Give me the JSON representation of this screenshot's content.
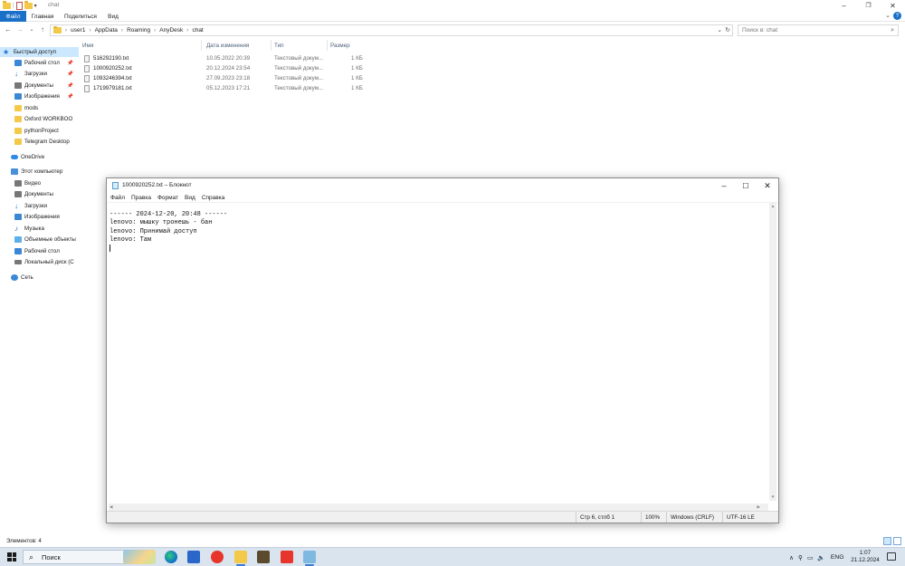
{
  "explorer": {
    "window_title": "chat",
    "ribbon_tabs": [
      "Файл",
      "Главная",
      "Поделиться",
      "Вид"
    ],
    "breadcrumb": [
      "user1",
      "AppData",
      "Roaming",
      "AnyDesk",
      "chat"
    ],
    "search_placeholder": "Поиск в: chat",
    "nav": {
      "quick_access": "Быстрый доступ",
      "quick_items": [
        "Рабочий стол",
        "Загрузки",
        "Документы",
        "Изображения",
        "mods",
        "Oxford WORKBOO",
        "pythonProject",
        "Telegram Desktop"
      ],
      "onedrive": "OneDrive",
      "this_pc": "Этот компьютер",
      "pc_items": [
        "Видео",
        "Документы",
        "Загрузки",
        "Изображения",
        "Музыка",
        "Объемные объекты",
        "Рабочий стол",
        "Локальный диск (C"
      ],
      "network": "Сеть"
    },
    "columns": [
      "Имя",
      "Дата изменения",
      "Тип",
      "Размер"
    ],
    "files": [
      {
        "name": "516292190.txt",
        "date": "10.05.2022 20:39",
        "type": "Текстовый докум...",
        "size": "1 КБ"
      },
      {
        "name": "1000920252.txt",
        "date": "20.12.2024 23:54",
        "type": "Текстовый докум...",
        "size": "1 КБ"
      },
      {
        "name": "1093246394.txt",
        "date": "27.09.2023 23:18",
        "type": "Текстовый докум...",
        "size": "1 КБ"
      },
      {
        "name": "1719979181.txt",
        "date": "05.12.2023 17:21",
        "type": "Текстовый докум...",
        "size": "1 КБ"
      }
    ],
    "status": "Элементов: 4"
  },
  "notepad": {
    "title": "1000920252.txt – Блокнот",
    "menu": [
      "Файл",
      "Правка",
      "Формат",
      "Вид",
      "Справка"
    ],
    "lines": [
      "------ 2024-12-20, 20:48 ------",
      "lenovo: мышку тронешь - бан",
      "lenovo: Принимай доступ",
      "lenovo: Там"
    ],
    "status": {
      "position": "Стр 6, стлб 1",
      "zoom": "100%",
      "line_endings": "Windows (CRLF)",
      "encoding": "UTF-16 LE"
    }
  },
  "taskbar": {
    "search_label": "Поиск",
    "lang": "ENG",
    "time": "1:07",
    "date": "21.12.2024"
  },
  "colors": {
    "accent": "#1a6fc9",
    "selection": "#cce8ff",
    "taskbar": "#d9e4ef"
  }
}
